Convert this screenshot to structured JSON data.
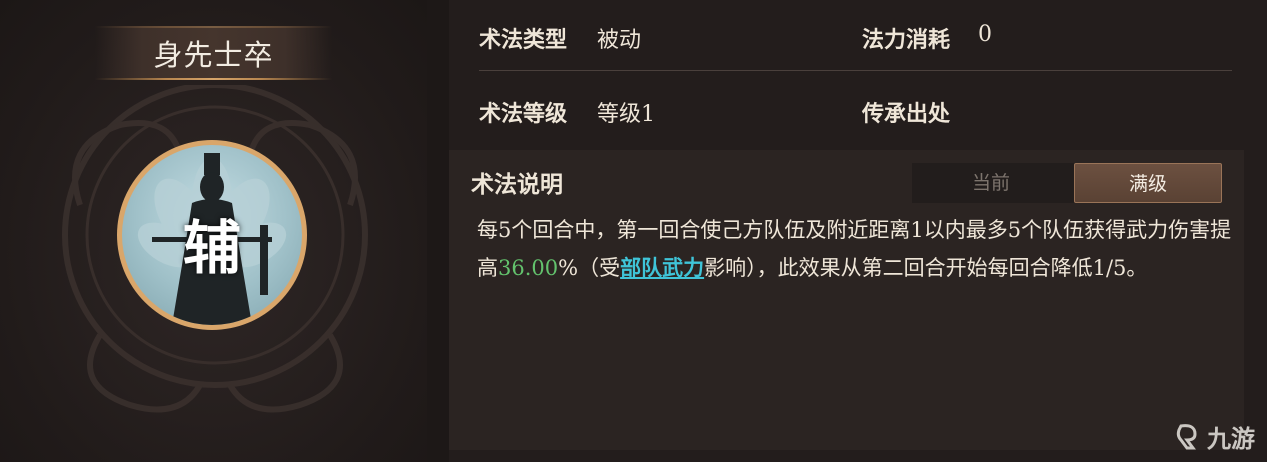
{
  "skill": {
    "name": "身先士卒",
    "portrait_char": "辅"
  },
  "info": {
    "type_label": "术法类型",
    "type_value": "被动",
    "cost_label": "法力消耗",
    "cost_value": "0",
    "level_label": "术法等级",
    "level_value": "等级1",
    "origin_label": "传承出处"
  },
  "description": {
    "title": "术法说明",
    "tabs": [
      {
        "label": "当前",
        "active": false
      },
      {
        "label": "满级",
        "active": true
      }
    ],
    "text_before": "每5个回合中，第一回合使己方队伍及附近距离1以内最多5个队伍获得武力伤害提高",
    "highlight_value": "36.00",
    "text_mid": "%（受",
    "link_text": "部队武力",
    "text_after": "影响），此效果从第二回合开始每回合降低1/5。"
  },
  "watermark": {
    "text": "九游"
  },
  "colors": {
    "highlight_green": "#63c26d",
    "link_cyan": "#3fc4d8",
    "portrait_ring": "#d9a66a",
    "active_tab": "#6c5040"
  }
}
